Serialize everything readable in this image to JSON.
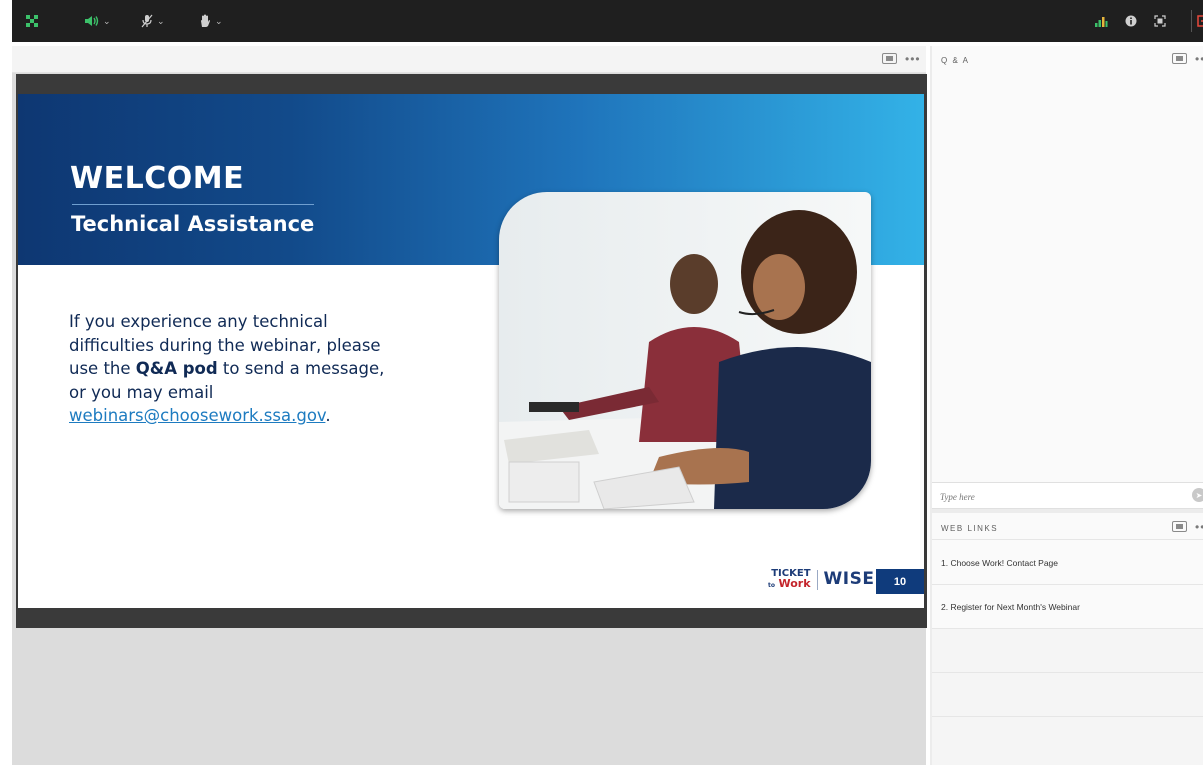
{
  "colors": {
    "toolbar_bg": "#1f1f1f",
    "audio_green": "#3cc16a",
    "leave_red": "#e8483b",
    "slide_navy": "#0f3b7c",
    "slide_cyan": "#33b2e7",
    "link_blue": "#1d7bc0"
  },
  "toolbar": {
    "icons": [
      "layout-grid-icon",
      "speaker-icon",
      "microphone-icon",
      "raise-hand-icon",
      "connection-status-icon",
      "info-icon",
      "fullscreen-icon",
      "leave-meeting-icon"
    ]
  },
  "slide": {
    "title": "WELCOME",
    "subtitle": "Technical Assistance",
    "body_part1": "If you experience any technical difficulties during the webinar, please use the ",
    "body_bold": "Q&A pod",
    "body_part2": " to send a message, or you may email ",
    "email": "webinars@choosework.ssa.gov",
    "body_end": ".",
    "logo_ticket": "TICKET",
    "logo_to": "to",
    "logo_work": "Work",
    "logo_wise": "WISE",
    "page_number": "10"
  },
  "qa_pod": {
    "title": "Q & A",
    "input_placeholder": "Type here"
  },
  "web_links_pod": {
    "title": "WEB LINKS",
    "items": [
      {
        "label": "1. Choose Work! Contact Page"
      },
      {
        "label": "2. Register for Next Month's Webinar"
      }
    ]
  }
}
